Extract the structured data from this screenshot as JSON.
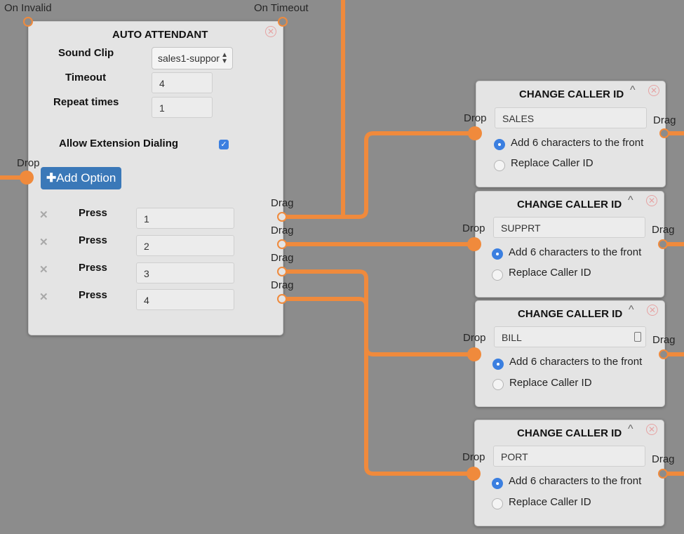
{
  "ports": {
    "on_invalid": "On Invalid",
    "on_timeout": "On Timeout",
    "drop": "Drop",
    "drag": "Drag"
  },
  "auto_attendant": {
    "title": "AUTO ATTENDANT",
    "sound_clip_label": "Sound Clip",
    "sound_clip_value": "sales1-suppor",
    "timeout_label": "Timeout",
    "timeout_value": "4",
    "repeat_label": "Repeat times",
    "repeat_value": "1",
    "ext_dial_label": "Allow Extension Dialing",
    "ext_dial_checked": true,
    "add_option_label": "Add Option",
    "press_label": "Press",
    "options": [
      "1",
      "2",
      "3",
      "4"
    ]
  },
  "change_caller_id_nodes": [
    {
      "title": "CHANGE CALLER ID",
      "value": "SALES",
      "option_prepend": "Add 6 characters to the front",
      "option_replace": "Replace Caller ID",
      "selected": "prepend"
    },
    {
      "title": "CHANGE CALLER ID",
      "value": "SUPPRT",
      "option_prepend": "Add 6 characters to the front",
      "option_replace": "Replace Caller ID",
      "selected": "prepend"
    },
    {
      "title": "CHANGE CALLER ID",
      "value": "BILL",
      "option_prepend": "Add 6 characters to the front",
      "option_replace": "Replace Caller ID",
      "selected": "prepend"
    },
    {
      "title": "CHANGE CALLER ID",
      "value": "PORT",
      "option_prepend": "Add 6 characters to the front",
      "option_replace": "Replace Caller ID",
      "selected": "prepend"
    }
  ],
  "colors": {
    "canvas": "#8c8c8c",
    "wire": "#f08a3c",
    "panel": "#e4e4e4",
    "accent": "#3a78b8",
    "radio_selected": "#3b7fe0"
  }
}
